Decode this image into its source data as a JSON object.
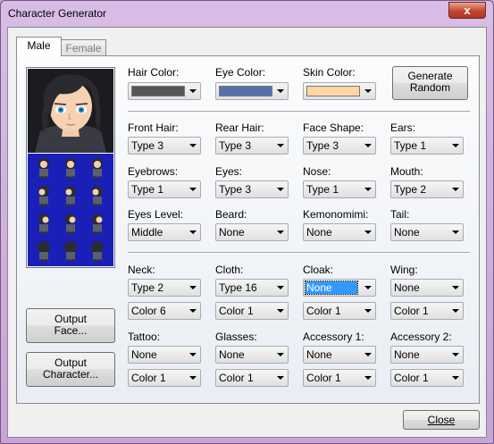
{
  "window": {
    "title": "Character Generator",
    "close_glyph": "x"
  },
  "tabs": [
    {
      "label": "Male",
      "selected": true
    },
    {
      "label": "Female",
      "selected": false
    }
  ],
  "colors": {
    "hair": "#565656",
    "eye": "#5870aa",
    "skin": "#ffd6a4",
    "sprite_bg": "#1a1fb8"
  },
  "row1": {
    "hair_color_label": "Hair Color:",
    "eye_color_label": "Eye Color:",
    "skin_color_label": "Skin Color:"
  },
  "generate_button": {
    "line1": "Generate",
    "line2": "Random"
  },
  "face": {
    "front_hair": {
      "label": "Front Hair:",
      "value": "Type 3"
    },
    "rear_hair": {
      "label": "Rear Hair:",
      "value": "Type 3"
    },
    "face_shape": {
      "label": "Face Shape:",
      "value": "Type 3"
    },
    "ears": {
      "label": "Ears:",
      "value": "Type 1"
    },
    "eyebrows": {
      "label": "Eyebrows:",
      "value": "Type 1"
    },
    "eyes": {
      "label": "Eyes:",
      "value": "Type 3"
    },
    "nose": {
      "label": "Nose:",
      "value": "Type 1"
    },
    "mouth": {
      "label": "Mouth:",
      "value": "Type 2"
    },
    "eyes_level": {
      "label": "Eyes Level:",
      "value": "Middle"
    },
    "beard": {
      "label": "Beard:",
      "value": "None"
    },
    "kemonomimi": {
      "label": "Kemonomimi:",
      "value": "None"
    },
    "tail": {
      "label": "Tail:",
      "value": "None"
    }
  },
  "body": {
    "neck": {
      "label": "Neck:",
      "value": "Type 2",
      "color": "Color 6"
    },
    "cloth": {
      "label": "Cloth:",
      "value": "Type 16",
      "color": "Color 1"
    },
    "cloak": {
      "label": "Cloak:",
      "value": "None",
      "color": "Color 1"
    },
    "wing": {
      "label": "Wing:",
      "value": "None",
      "color": "Color 1"
    },
    "tattoo": {
      "label": "Tattoo:",
      "value": "None",
      "color": "Color 1"
    },
    "glasses": {
      "label": "Glasses:",
      "value": "None",
      "color": "Color 1"
    },
    "accessory1": {
      "label": "Accessory 1:",
      "value": "None",
      "color": "Color 1"
    },
    "accessory2": {
      "label": "Accessory 2:",
      "value": "None",
      "color": "Color 1"
    }
  },
  "output_face_button": {
    "line1": "Output",
    "line2": "Face..."
  },
  "output_character_button": {
    "line1": "Output",
    "line2": "Character..."
  },
  "close_button": {
    "label": "Close"
  }
}
